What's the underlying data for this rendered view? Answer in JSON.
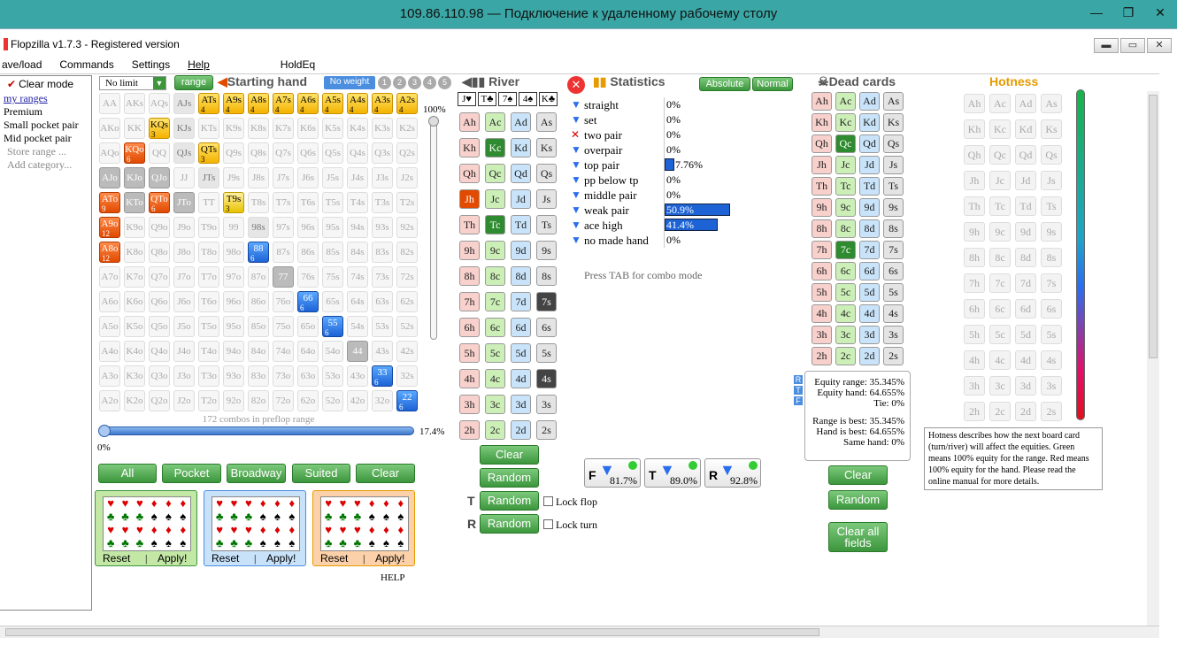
{
  "rdp": {
    "title": "109.86.110.98 — Подключение к удаленному рабочему столу"
  },
  "app": {
    "title": "Flopzilla v1.7.3 - Registered version"
  },
  "menu": [
    "ave/load",
    "Commands",
    "Settings",
    "Help",
    "HoldEq"
  ],
  "sidebar": {
    "clear": "Clear mode",
    "categories": [
      "my ranges",
      "Premium",
      "Small pocket pair",
      "Mid pocket pair",
      "Store range ...",
      "Add category..."
    ]
  },
  "toolbar": {
    "limit": "No limit",
    "range": "range",
    "starting": "Starting hand",
    "noweight": "No weight",
    "weights": [
      "1",
      "2",
      "3",
      "4",
      "5"
    ],
    "river": "River",
    "stats": "Statistics",
    "absolute": "Absolute",
    "normal": "Normal",
    "dead": "Dead cards",
    "hotness": "Hotness"
  },
  "flop": [
    "J♥",
    "T♣",
    "7♠",
    "4♠",
    "K♣"
  ],
  "matrix": {
    "cells": [
      [
        "AA",
        "AKs",
        "AQs",
        "AJs",
        "ATs",
        "A9s",
        "A8s",
        "A7s",
        "A6s",
        "A5s",
        "A4s",
        "A3s",
        "A2s"
      ],
      [
        "AKo",
        "KK",
        "KQs",
        "KJs",
        "KTs",
        "K9s",
        "K8s",
        "K7s",
        "K6s",
        "K5s",
        "K4s",
        "K3s",
        "K2s"
      ],
      [
        "AQo",
        "KQo",
        "QQ",
        "QJs",
        "QTs",
        "Q9s",
        "Q8s",
        "Q7s",
        "Q6s",
        "Q5s",
        "Q4s",
        "Q3s",
        "Q2s"
      ],
      [
        "AJo",
        "KJo",
        "QJo",
        "JJ",
        "JTs",
        "J9s",
        "J8s",
        "J7s",
        "J6s",
        "J5s",
        "J4s",
        "J3s",
        "J2s"
      ],
      [
        "ATo",
        "KTo",
        "QTo",
        "JTo",
        "TT",
        "T9s",
        "T8s",
        "T7s",
        "T6s",
        "T5s",
        "T4s",
        "T3s",
        "T2s"
      ],
      [
        "A9o",
        "K9o",
        "Q9o",
        "J9o",
        "T9o",
        "99",
        "98s",
        "97s",
        "96s",
        "95s",
        "94s",
        "93s",
        "92s"
      ],
      [
        "A8o",
        "K8o",
        "Q8o",
        "J8o",
        "T8o",
        "98o",
        "88",
        "87s",
        "86s",
        "85s",
        "84s",
        "83s",
        "82s"
      ],
      [
        "A7o",
        "K7o",
        "Q7o",
        "J7o",
        "T7o",
        "97o",
        "87o",
        "77",
        "76s",
        "75s",
        "74s",
        "73s",
        "72s"
      ],
      [
        "A6o",
        "K6o",
        "Q6o",
        "J6o",
        "T6o",
        "96o",
        "86o",
        "76o",
        "66",
        "65s",
        "64s",
        "63s",
        "62s"
      ],
      [
        "A5o",
        "K5o",
        "Q5o",
        "J5o",
        "T5o",
        "95o",
        "85o",
        "75o",
        "65o",
        "55",
        "54s",
        "53s",
        "52s"
      ],
      [
        "A4o",
        "K4o",
        "Q4o",
        "J4o",
        "T4o",
        "94o",
        "84o",
        "74o",
        "64o",
        "54o",
        "44",
        "43s",
        "42s"
      ],
      [
        "A3o",
        "K3o",
        "Q3o",
        "J3o",
        "T3o",
        "93o",
        "83o",
        "73o",
        "63o",
        "53o",
        "43o",
        "33",
        "32s"
      ],
      [
        "A2o",
        "K2o",
        "Q2o",
        "J2o",
        "T2o",
        "92o",
        "82o",
        "72o",
        "62o",
        "52o",
        "42o",
        "32o",
        "22"
      ]
    ],
    "combos": "172 combos in preflop range",
    "pct_top": "100%",
    "pct_left": "0%",
    "pct_right": "17.4%"
  },
  "buttons": {
    "all": "All",
    "pocket": "Pocket",
    "broadway": "Broadway",
    "suited": "Suited",
    "clear": "Clear",
    "reset": "Reset",
    "apply": "Apply!",
    "help": "HELP",
    "random": "Random",
    "lockflop": "Lock flop",
    "lockturn": "Lock turn",
    "clearall": "Clear all fields"
  },
  "stats": [
    {
      "label": "straight",
      "value": "0%",
      "pct": 0
    },
    {
      "label": "set",
      "value": "0%",
      "pct": 0
    },
    {
      "label": "two pair",
      "value": "0%",
      "pct": 0
    },
    {
      "label": "overpair",
      "value": "0%",
      "pct": 0
    },
    {
      "label": "top pair",
      "value": "7.76%",
      "pct": 7.76
    },
    {
      "label": "pp below tp",
      "value": "0%",
      "pct": 0
    },
    {
      "label": "middle pair",
      "value": "0%",
      "pct": 0
    },
    {
      "label": "weak pair",
      "value": "50.9%",
      "pct": 50.9
    },
    {
      "label": "ace high",
      "value": "41.4%",
      "pct": 41.4
    },
    {
      "label": "no made hand",
      "value": "0%",
      "pct": 0
    }
  ],
  "tabhint": "Press TAB for combo mode",
  "filters": [
    {
      "l": "F",
      "v": "81.7%"
    },
    {
      "l": "T",
      "v": "89.0%"
    },
    {
      "l": "R",
      "v": "92.8%"
    }
  ],
  "equity": {
    "range": "Equity range: 35.345%",
    "hand": "Equity hand: 64.655%",
    "tie": "Tie: 0%",
    "rbest": "Range is best: 35.345%",
    "hbest": "Hand is best: 64.655%",
    "same": "Same hand: 0%"
  },
  "hotness_note": "Hotness describes how the next board card (turn/river) will affect the equities. Green means 100% equity for the range. Red means 100% equity for the hand. Please read the online manual for more details.",
  "ranks": [
    "A",
    "K",
    "Q",
    "J",
    "T",
    "9",
    "8",
    "7",
    "6",
    "5",
    "4",
    "3",
    "2"
  ],
  "suits": [
    "h",
    "c",
    "d",
    "s"
  ],
  "colors": {
    "accent": "#3c963c",
    "teal": "#3aa7a6"
  }
}
